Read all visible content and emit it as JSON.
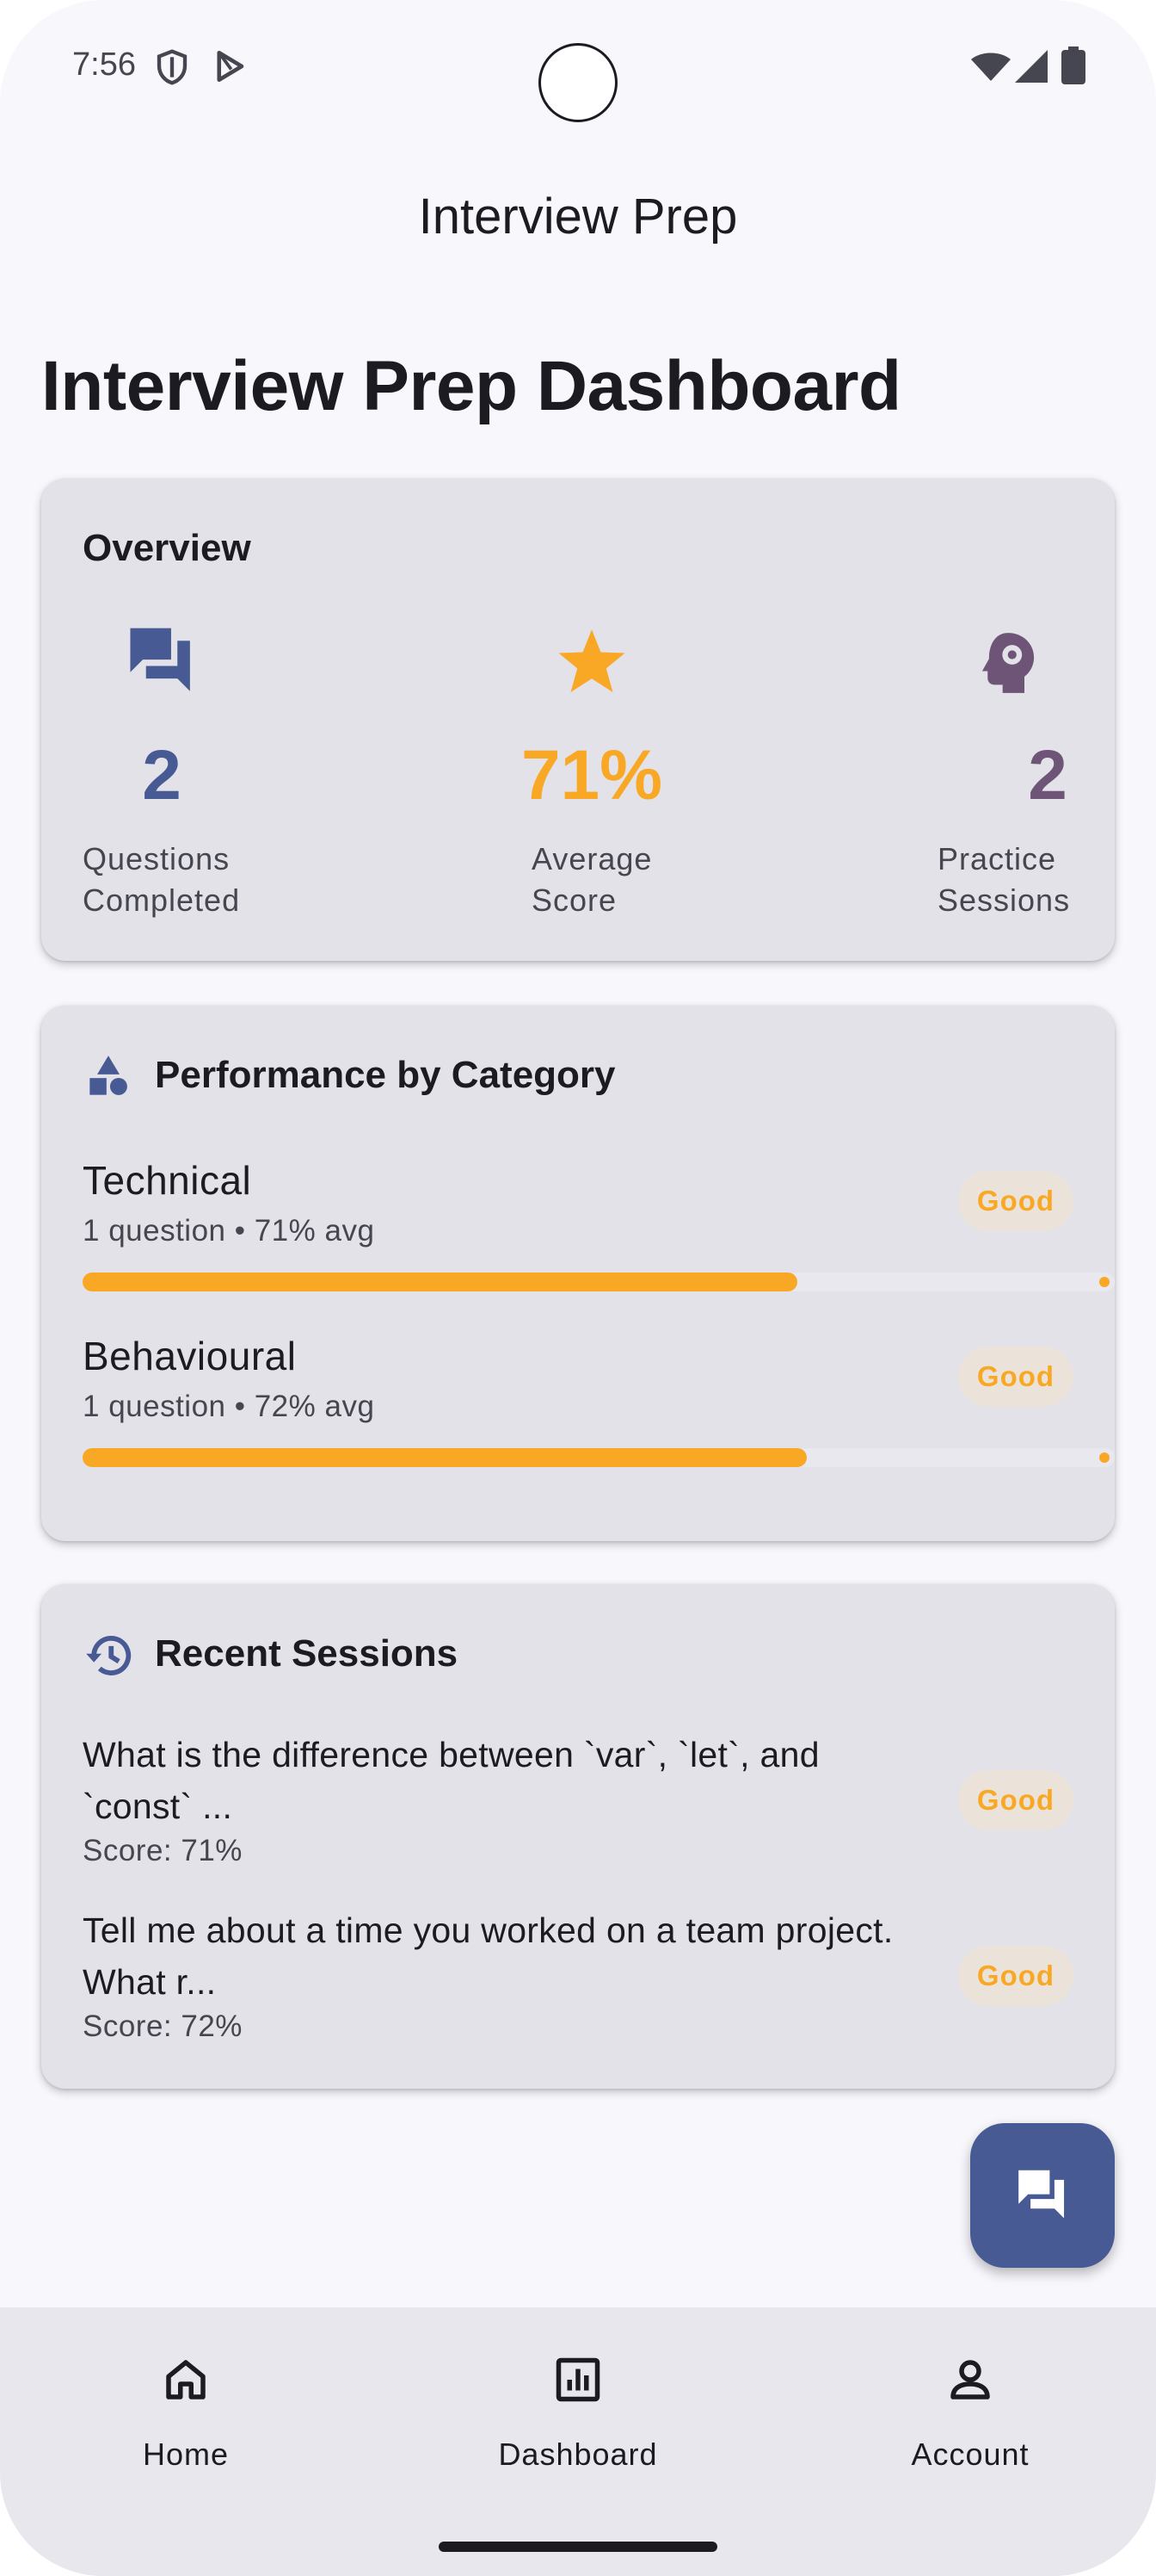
{
  "status_bar": {
    "time": "7:56"
  },
  "app_bar": {
    "title": "Interview Prep"
  },
  "page": {
    "heading": "Interview Prep Dashboard"
  },
  "overview": {
    "title": "Overview",
    "stats": [
      {
        "value": "2",
        "label_line1": "Questions",
        "label_line2": "Completed",
        "icon": "forum-icon",
        "color": "#475a94"
      },
      {
        "value": "71%",
        "label_line1": "Average",
        "label_line2": "Score",
        "icon": "star-icon",
        "color": "#f9a825"
      },
      {
        "value": "2",
        "label_line1": "Practice",
        "label_line2": "Sessions",
        "icon": "psychology-icon",
        "color": "#6e5476"
      }
    ]
  },
  "performance": {
    "title": "Performance by Category",
    "icon": "category-icon",
    "categories": [
      {
        "name": "Technical",
        "subtitle": "1 question • 71% avg",
        "badge": "Good",
        "progress": 0.71
      },
      {
        "name": "Behavioural",
        "subtitle": "1 question • 72% avg",
        "badge": "Good",
        "progress": 0.72
      }
    ]
  },
  "recent_sessions": {
    "title": "Recent Sessions",
    "icon": "history-icon",
    "sessions": [
      {
        "question_line1": "What is the difference between `var`, `let`, and",
        "question_line2": "`const` ...",
        "score": "Score: 71%",
        "badge": "Good"
      },
      {
        "question_line1": "Tell me about a time you worked on a team project.",
        "question_line2": "What r...",
        "score": "Score: 72%",
        "badge": "Good"
      }
    ]
  },
  "fab": {
    "icon": "chat-icon"
  },
  "bottom_nav": {
    "items": [
      {
        "label": "Home",
        "icon": "home-icon"
      },
      {
        "label": "Dashboard",
        "icon": "dashboard-icon"
      },
      {
        "label": "Account",
        "icon": "account-icon"
      }
    ]
  },
  "colors": {
    "primary": "#475a94",
    "accent": "#f9a825",
    "tertiary": "#6e5476",
    "card": "#e3e2e8",
    "badge_bg": "#ebe3d9"
  }
}
